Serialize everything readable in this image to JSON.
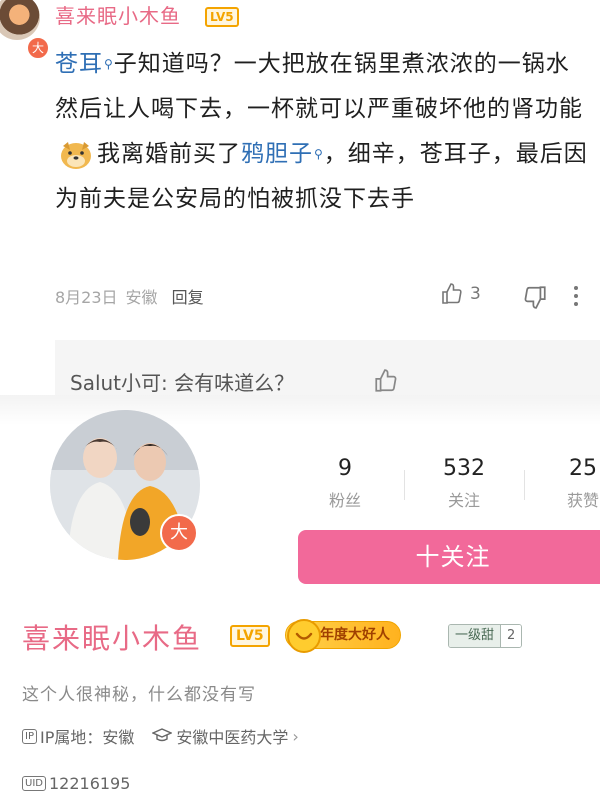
{
  "comment": {
    "username": "喜来眠小木鱼",
    "level_badge": "LV5",
    "avatar_badge": "大",
    "text_keyword1": "苍耳",
    "text_part1": "子知道吗？一大把放在锅里煮浓浓的一锅水然后让人喝下去，一杯就可以严重破坏他的肾功能",
    "text_part2": "我离婚前买了",
    "text_keyword2": "鸦胆子",
    "text_part3": "，细辛，苍耳子，最后因为前夫是公安局的怕被抓没下去手",
    "date": "8月23日",
    "location": "安徽",
    "reply_label": "回复",
    "like_count": "3",
    "sub_reply": "Salut小可: 会有味道么？"
  },
  "profile": {
    "avatar_badge": "大",
    "stats": [
      {
        "value": "9",
        "label": "粉丝"
      },
      {
        "value": "532",
        "label": "关注"
      },
      {
        "value": "25",
        "label": "获赞"
      }
    ],
    "follow_label": "十关注",
    "name": "喜来眠小木鱼",
    "level_badge": "LV5",
    "award_badge": "年度大好人",
    "sweet_badge": "一级甜",
    "sweet_level": "2",
    "bio": "这个人很神秘，什么都没有写",
    "ip_tag": "IP",
    "ip_text": "IP属地：安徽",
    "school": "安徽中医药大学",
    "uid_tag": "UID",
    "uid": "12216195"
  },
  "icons": {
    "search_marker": "magnifier-icon",
    "like": "thumb-up-icon",
    "dislike": "thumb-down-icon",
    "more": "more-vertical-icon",
    "school": "graduation-cap-icon",
    "chevron": "chevron-right-icon"
  },
  "colors": {
    "username": "#e86a86",
    "keyword": "#2f6fb5",
    "follow_button": "#f2699a",
    "level_badge": "#f4a400"
  }
}
